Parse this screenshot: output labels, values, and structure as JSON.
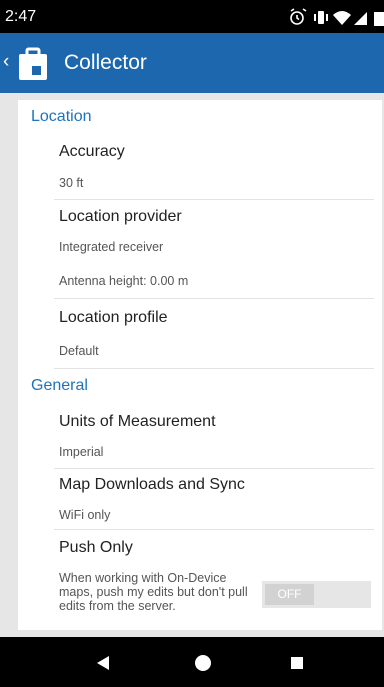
{
  "status_bar": {
    "time": "2:47"
  },
  "app_bar": {
    "title": "Collector"
  },
  "settings": {
    "location_header": "Location",
    "accuracy_title": "Accuracy",
    "accuracy_value": "30 ft",
    "provider_title": "Location provider",
    "provider_value": "Integrated receiver",
    "antenna_value": "Antenna height: 0.00 m",
    "profile_title": "Location profile",
    "profile_value": "Default",
    "general_header": "General",
    "units_title": "Units of Measurement",
    "units_value": "Imperial",
    "downloads_title": "Map Downloads and Sync",
    "downloads_value": "WiFi only",
    "push_title": "Push Only",
    "push_description": "When working with On-Device maps, push my edits but don't pull edits from the server.",
    "push_toggle_label": "OFF",
    "push_toggle_state": false
  },
  "colors": {
    "app_bar": "#1c67ad",
    "section_header": "#1e73be",
    "toggle_track": "#e6e6e6",
    "toggle_thumb": "#d2d2d2"
  },
  "icons": [
    "alarm-icon",
    "vibrate-icon",
    "wifi-icon",
    "signal-icon",
    "battery-icon",
    "back-icon",
    "home-icon",
    "recents-icon"
  ]
}
